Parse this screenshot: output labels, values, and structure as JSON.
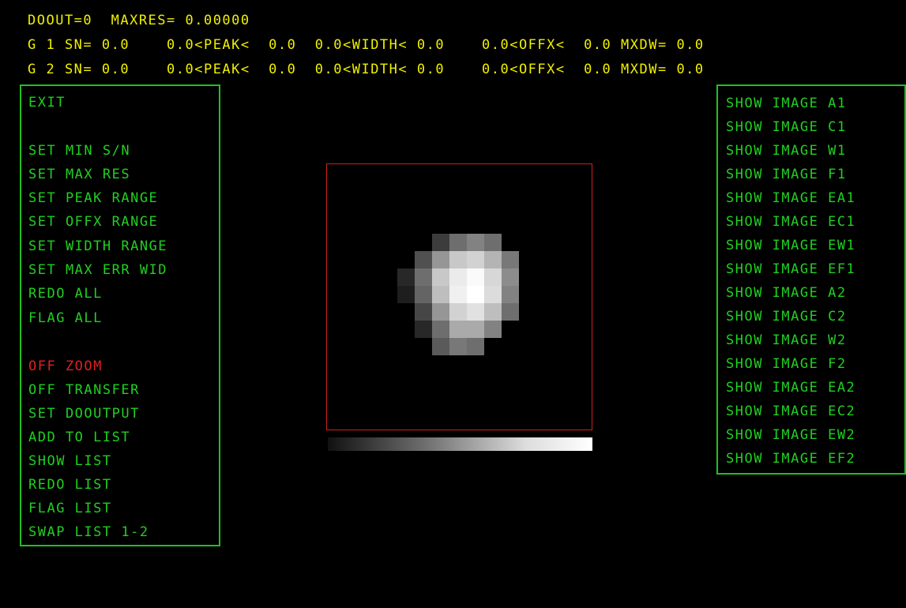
{
  "header": {
    "line1": "DOOUT=0  MAXRES= 0.00000",
    "line2": "G 1 SN= 0.0    0.0<PEAK<  0.0  0.0<WIDTH< 0.0    0.0<OFFX<  0.0 MXDW= 0.0",
    "line3": "G 2 SN= 0.0    0.0<PEAK<  0.0  0.0<WIDTH< 0.0    0.0<OFFX<  0.0 MXDW= 0.0"
  },
  "left_menu": {
    "items": [
      {
        "label": "EXIT"
      },
      {
        "label": "SET MIN S/N"
      },
      {
        "label": "SET MAX RES"
      },
      {
        "label": "SET PEAK RANGE"
      },
      {
        "label": "SET OFFX RANGE"
      },
      {
        "label": "SET WIDTH RANGE"
      },
      {
        "label": "SET MAX ERR WID"
      },
      {
        "label": "REDO ALL"
      },
      {
        "label": "FLAG ALL"
      },
      {
        "label": "OFF ZOOM"
      },
      {
        "label": "OFF TRANSFER"
      },
      {
        "label": "SET DOOUTPUT"
      },
      {
        "label": "ADD TO LIST"
      },
      {
        "label": "SHOW LIST"
      },
      {
        "label": "REDO LIST"
      },
      {
        "label": "FLAG LIST"
      },
      {
        "label": "SWAP LIST 1-2"
      }
    ]
  },
  "right_menu": {
    "items": [
      {
        "label": "SHOW IMAGE A1"
      },
      {
        "label": "SHOW IMAGE C1"
      },
      {
        "label": "SHOW IMAGE W1"
      },
      {
        "label": "SHOW IMAGE F1"
      },
      {
        "label": "SHOW IMAGE EA1"
      },
      {
        "label": "SHOW IMAGE EC1"
      },
      {
        "label": "SHOW IMAGE EW1"
      },
      {
        "label": "SHOW IMAGE EF1"
      },
      {
        "label": "SHOW IMAGE A2"
      },
      {
        "label": "SHOW IMAGE C2"
      },
      {
        "label": "SHOW IMAGE W2"
      },
      {
        "label": "SHOW IMAGE F2"
      },
      {
        "label": "SHOW IMAGE EA2"
      },
      {
        "label": "SHOW IMAGE EC2"
      },
      {
        "label": "SHOW IMAGE EW2"
      },
      {
        "label": "SHOW IMAGE EF2"
      }
    ]
  },
  "colors": {
    "background": "#000000",
    "header_text": "#f0f000",
    "menu_text": "#20d020",
    "menu_border": "#20c020",
    "active_text": "#e02020",
    "zoom_border": "#d02020"
  },
  "image": {
    "description": "grayscale zoomed pixel blob",
    "pixel_rows": [
      [
        0,
        0,
        0,
        0,
        0,
        0,
        0,
        0
      ],
      [
        0,
        0,
        60,
        110,
        130,
        110,
        0,
        0
      ],
      [
        0,
        80,
        150,
        200,
        210,
        180,
        120,
        0
      ],
      [
        40,
        110,
        200,
        235,
        250,
        215,
        140,
        0
      ],
      [
        30,
        100,
        190,
        240,
        255,
        220,
        130,
        0
      ],
      [
        0,
        70,
        150,
        210,
        225,
        190,
        110,
        0
      ],
      [
        0,
        40,
        110,
        170,
        170,
        130,
        0,
        0
      ],
      [
        0,
        0,
        90,
        120,
        110,
        0,
        0,
        0
      ]
    ]
  }
}
